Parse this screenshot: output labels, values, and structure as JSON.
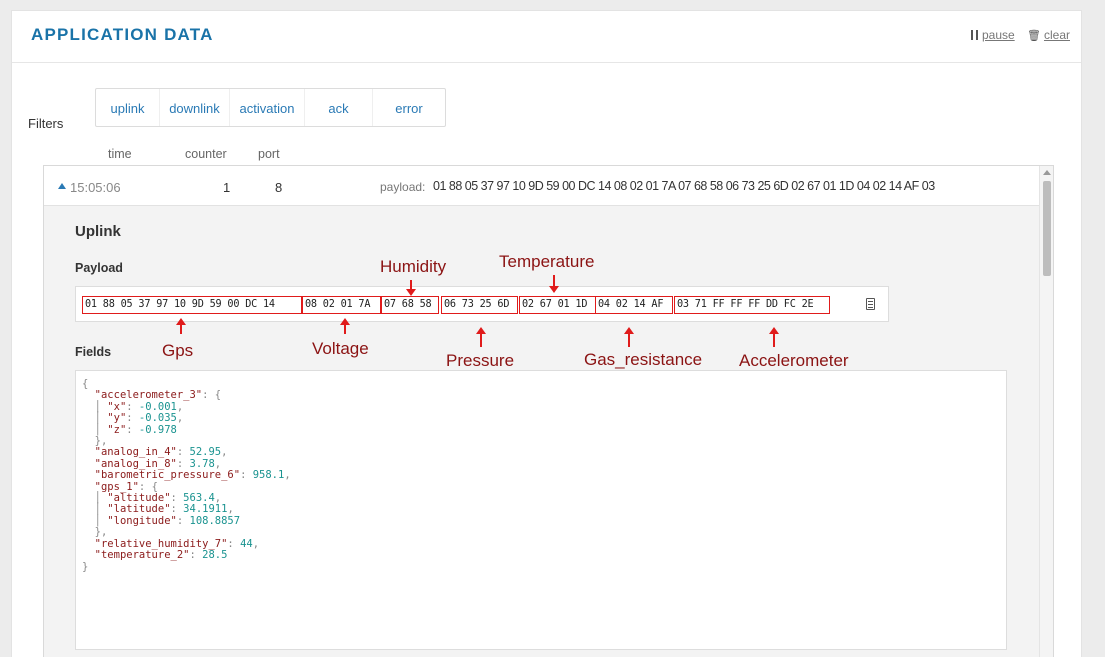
{
  "header": {
    "title": "APPLICATION DATA",
    "pause_label": "pause",
    "clear_label": "clear",
    "pause_icon": "pause-icon",
    "clear_icon": "trash-icon"
  },
  "filters": {
    "label": "Filters",
    "items": [
      "uplink",
      "downlink",
      "activation",
      "ack",
      "error"
    ]
  },
  "columns": {
    "time": "time",
    "counter": "counter",
    "port": "port"
  },
  "message": {
    "time": "15:05:06",
    "counter": "1",
    "port": "8",
    "payload_label": "payload:",
    "payload_value": "01 88 05 37 97 10 9D 59 00 DC 14 08 02 01 7A 07 68 58 06 73 25 6D 02 67 01 1D 04 02 14 AF 03"
  },
  "detail": {
    "title": "Uplink",
    "payload_heading": "Payload",
    "fields_heading": "Fields",
    "segments": [
      "01 88 05 37 97 10 9D 59 00 DC 14",
      "08 02 01 7A",
      "07 68 58",
      "06 73 25 6D",
      "02 67 01 1D",
      "04 02 14 AF",
      "03 71 FF FF FF DD FC 2E"
    ],
    "annotations": {
      "gps": "Gps",
      "voltage": "Voltage",
      "humidity": "Humidity",
      "pressure": "Pressure",
      "temperature": "Temperature",
      "gas_resistance": "Gas_resistance",
      "accelerometer": "Accelerometer"
    },
    "json_lines": [
      [
        "{",
        "",
        ""
      ],
      [
        "  ",
        "\"accelerometer_3\"",
        ": {"
      ],
      [
        "  │ ",
        "\"x\"",
        ": -0.001,"
      ],
      [
        "  │ ",
        "\"y\"",
        ": -0.035,"
      ],
      [
        "  │ ",
        "\"z\"",
        ": -0.978"
      ],
      [
        "  },",
        "",
        ""
      ],
      [
        "  ",
        "\"analog_in_4\"",
        ": 52.95,"
      ],
      [
        "  ",
        "\"analog_in_8\"",
        ": 3.78,"
      ],
      [
        "  ",
        "\"barometric_pressure_6\"",
        ": 958.1,"
      ],
      [
        "  ",
        "\"gps_1\"",
        ": {"
      ],
      [
        "  │ ",
        "\"altitude\"",
        ": 563.4,"
      ],
      [
        "  │ ",
        "\"latitude\"",
        ": 34.1911,"
      ],
      [
        "  │ ",
        "\"longitude\"",
        ": 108.8857"
      ],
      [
        "  },",
        "",
        ""
      ],
      [
        "  ",
        "\"relative_humidity_7\"",
        ": 44,"
      ],
      [
        "  ",
        "\"temperature_2\"",
        ": 28.5"
      ],
      [
        "}",
        "",
        ""
      ]
    ]
  }
}
